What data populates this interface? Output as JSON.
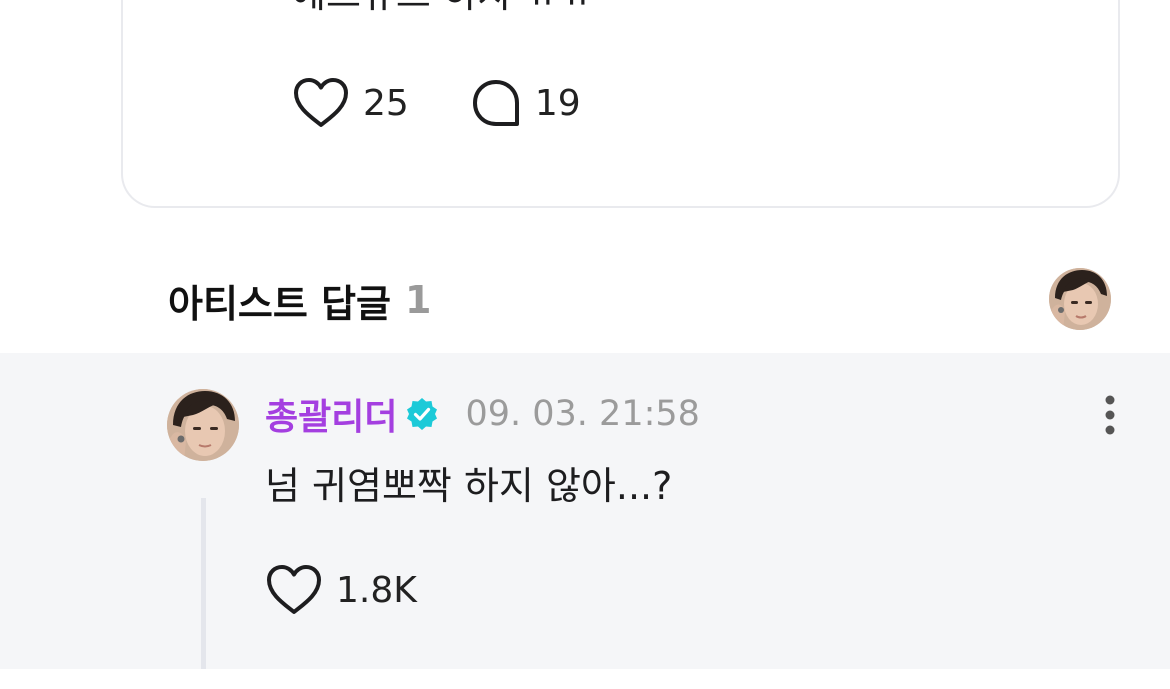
{
  "post": {
    "text": "에스큐스 하자 ㅠㅠ",
    "like_count": "25",
    "comment_count": "19"
  },
  "artist_section": {
    "title": "아티스트 답글",
    "count": "1"
  },
  "reply": {
    "author": "총괄리더",
    "timestamp": "09. 03. 21:58",
    "text": "넘 귀염뽀짝 하지 않아...?",
    "like_count": "1.8K"
  },
  "icons": {
    "like": "heart-outline-icon",
    "comment": "speech-bubble-icon",
    "verified": "verified-badge-icon",
    "more": "vertical-ellipsis-icon"
  },
  "colors": {
    "author_name": "#a43fe0",
    "verified_badge": "#1ccad8",
    "timestamp": "#9b9b9b",
    "reply_background": "#f5f6f8",
    "section_count": "#9a9a9a"
  }
}
